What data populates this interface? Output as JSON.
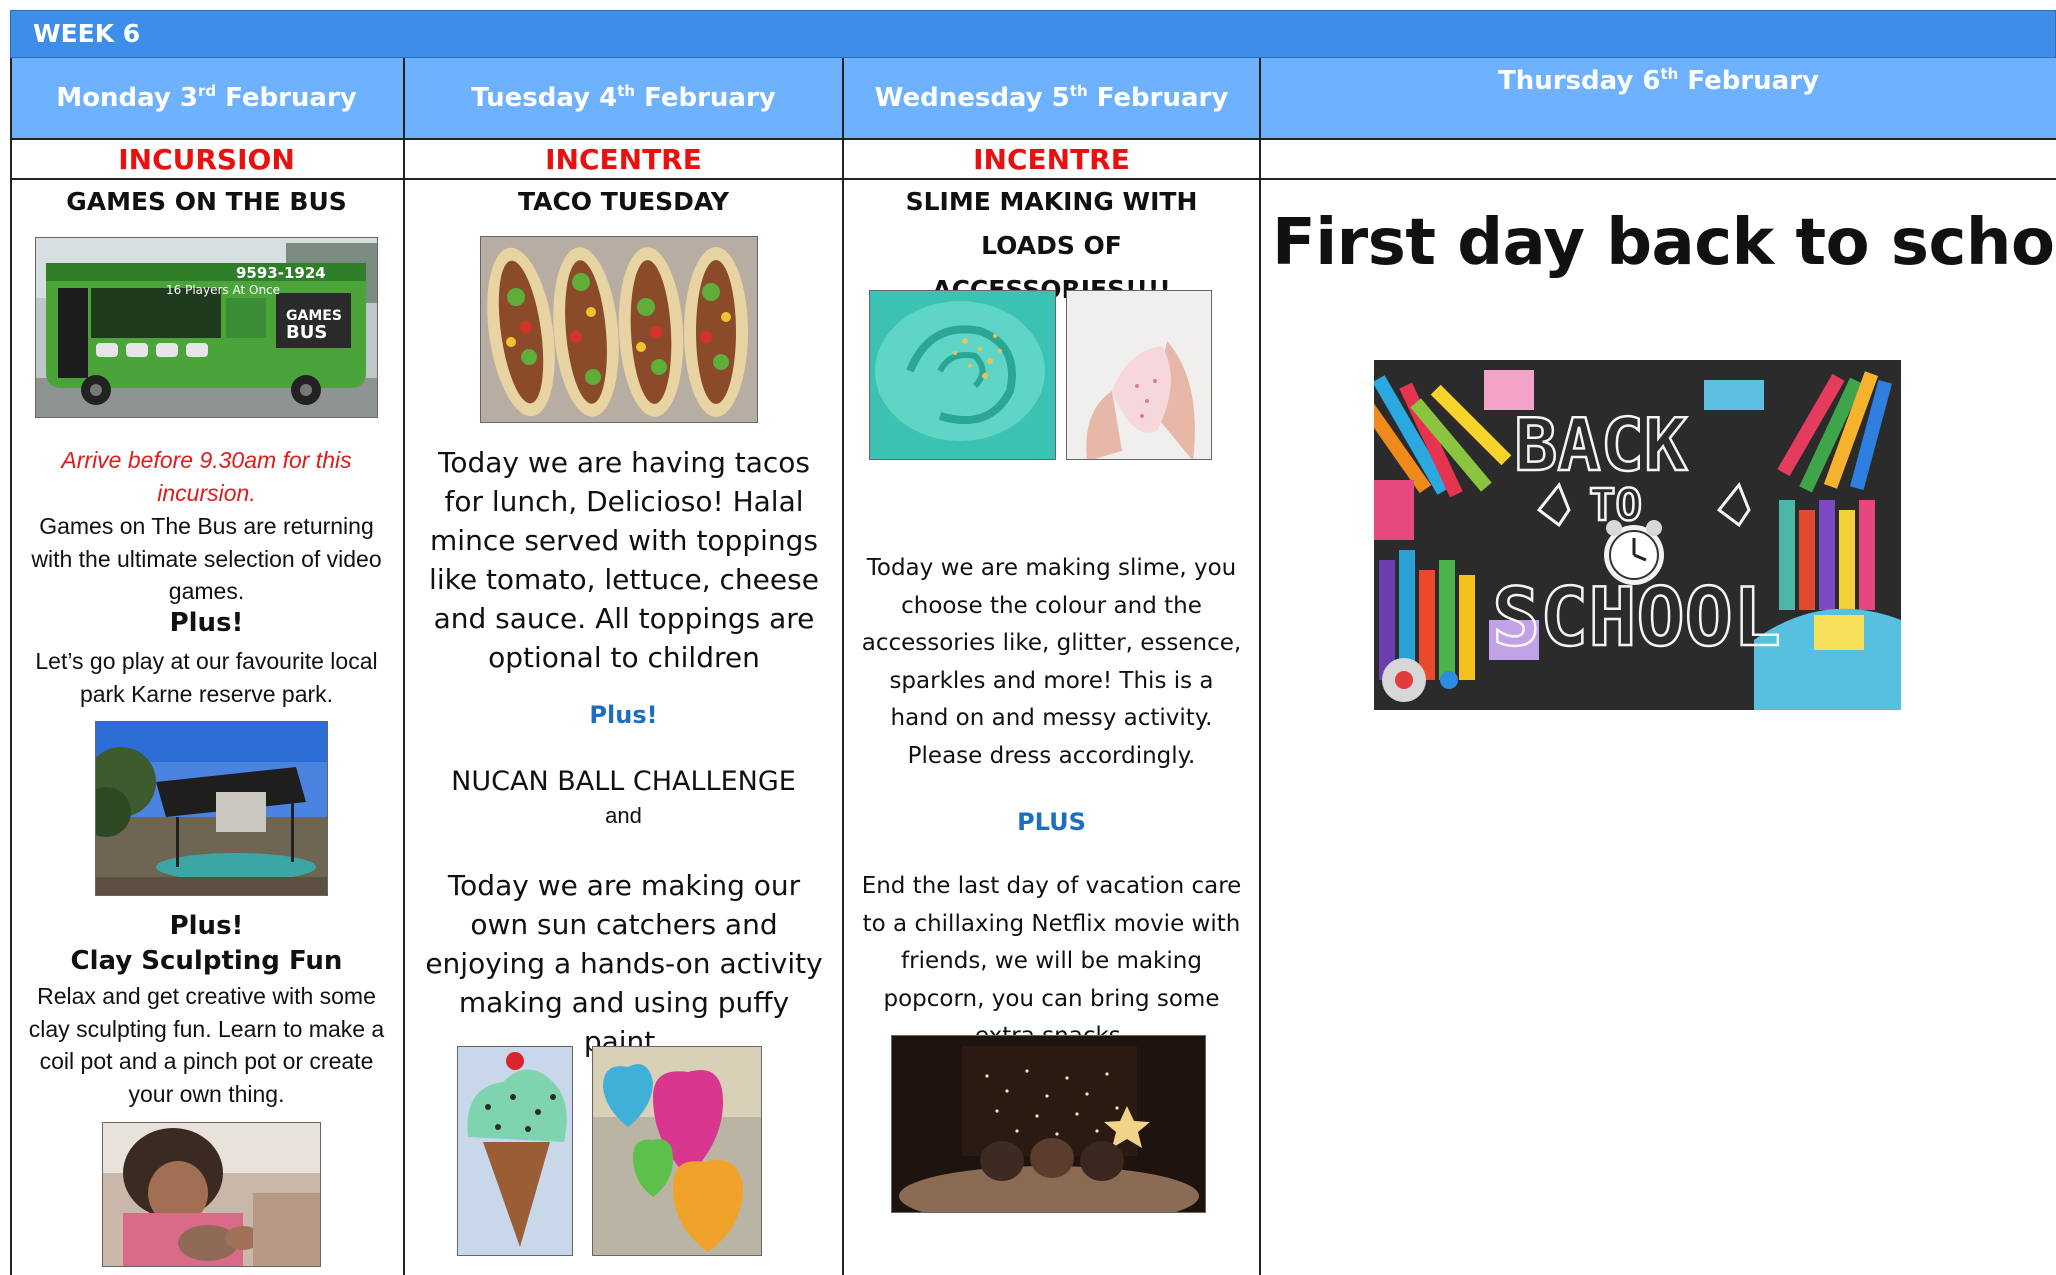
{
  "week": {
    "label": "WEEK 6"
  },
  "days": [
    {
      "name_pre": "Monday 3",
      "sup": "rd",
      "name_post": " February",
      "type": "INCURSION"
    },
    {
      "name_pre": "Tuesday 4",
      "sup": "th",
      "name_post": " February",
      "type": "INCENTRE"
    },
    {
      "name_pre": "Wednesday 5",
      "sup": "th",
      "name_post": " February",
      "type": "INCENTRE"
    },
    {
      "name_pre": "Thursday 6",
      "sup": "th",
      "name_post": " February",
      "type": ""
    }
  ],
  "monday": {
    "title": "GAMES ON THE BUS",
    "bus_phone": "9593-1924",
    "bus_tagline": "16 Players At Once",
    "bus_logo_line1": "GAMES",
    "bus_logo_line2": "BUS",
    "arrive_note": "Arrive before 9.30am for this incursion.",
    "desc": "Games on The Bus are returning with the ultimate selection of video games.",
    "plus1": "Plus!",
    "park_desc": "Let’s go play at our favourite local park Karne reserve park.",
    "plus2": "Plus!",
    "clay_title": "Clay Sculpting Fun",
    "clay_desc": "Relax and get creative with some clay sculpting fun. Learn to make a coil pot and a pinch pot or create your own thing."
  },
  "tuesday": {
    "title": "TACO TUESDAY",
    "desc": "Today we are having tacos for lunch, Delicioso! Halal mince served with toppings like tomato, lettuce, cheese and sauce. All toppings are optional to children",
    "plus": "Plus!",
    "challenge": "NUCAN BALL CHALLENGE",
    "and": "and",
    "sun_desc": "Today we are making our own sun catchers and enjoying a hands-on activity making and using puffy paint."
  },
  "wednesday": {
    "title": "SLIME MAKING WITH LOADS OF ACCESSORIES!!!!",
    "desc": "Today we are making slime, you choose the colour and the accessories like, glitter, essence, sparkles and more! This is a hand on and messy activity. Please dress accordingly.",
    "plus": "PLUS",
    "movie_desc": "End the last day of vacation care to a chillaxing Netflix movie with friends, we will be making popcorn, you can bring some extra snacks."
  },
  "thursday": {
    "big_title": "First day back to school",
    "chalk_line1": "BACK",
    "chalk_line2": "TO",
    "chalk_line3": "SCHOOL"
  },
  "colors": {
    "week_bar": "#3d8ee8",
    "header_bg": "#6db1ff",
    "type_red": "#e8110f",
    "plus_blue": "#1c6fc0"
  }
}
